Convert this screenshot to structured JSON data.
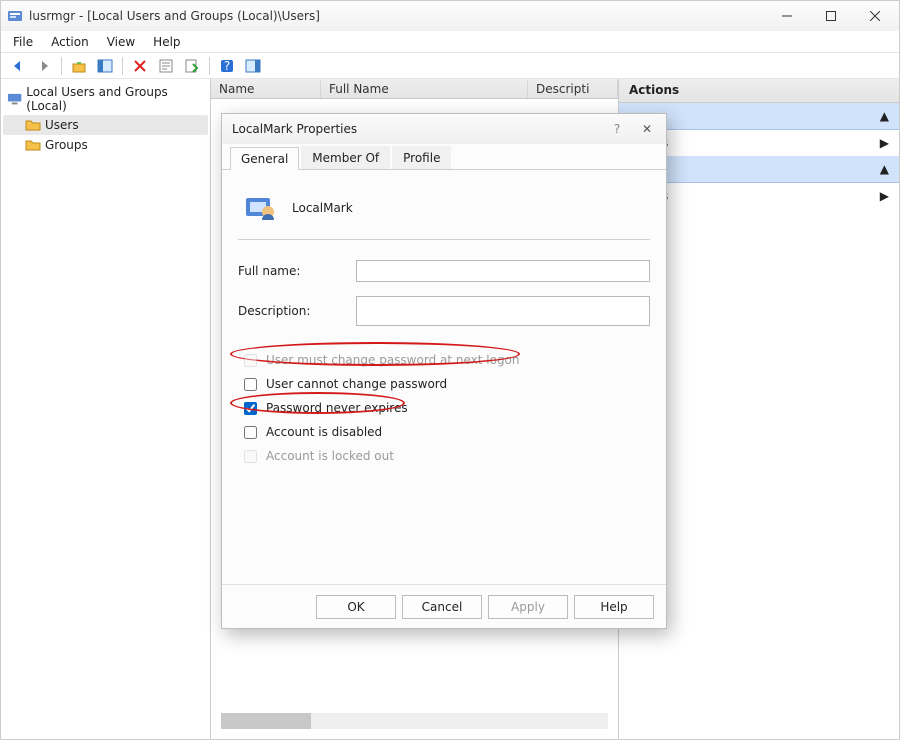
{
  "window": {
    "title": "lusrmgr - [Local Users and Groups (Local)\\Users]",
    "menus": [
      "File",
      "Action",
      "View",
      "Help"
    ]
  },
  "tree": {
    "root": "Local Users and Groups (Local)",
    "items": [
      "Users",
      "Groups"
    ],
    "selected": 0
  },
  "list": {
    "columns": [
      "Name",
      "Full Name",
      "Descripti"
    ]
  },
  "actions": {
    "title": "Actions",
    "groups": [
      {
        "arrow": "▲",
        "items": [
          {
            "label": "ons",
            "arrow": "▶"
          }
        ]
      },
      {
        "arrow": "▲",
        "items": [
          {
            "label": "ons",
            "arrow": "▶"
          }
        ]
      }
    ]
  },
  "dialog": {
    "title": "LocalMark Properties",
    "username": "LocalMark",
    "tabs": [
      "General",
      "Member Of",
      "Profile"
    ],
    "active_tab": 0,
    "fields": {
      "full_name_label": "Full name:",
      "full_name_value": "",
      "description_label": "Description:",
      "description_value": ""
    },
    "checks": [
      {
        "label": "User must change password at next logon",
        "checked": false,
        "disabled": true,
        "annotated": true
      },
      {
        "label": "User cannot change password",
        "checked": false,
        "disabled": false,
        "annotated": false
      },
      {
        "label": "Password never expires",
        "checked": true,
        "disabled": false,
        "annotated": true
      },
      {
        "label": "Account is disabled",
        "checked": false,
        "disabled": false,
        "annotated": false
      },
      {
        "label": "Account is locked out",
        "checked": false,
        "disabled": true,
        "annotated": false
      }
    ],
    "buttons": {
      "ok": "OK",
      "cancel": "Cancel",
      "apply": "Apply",
      "help": "Help"
    }
  }
}
